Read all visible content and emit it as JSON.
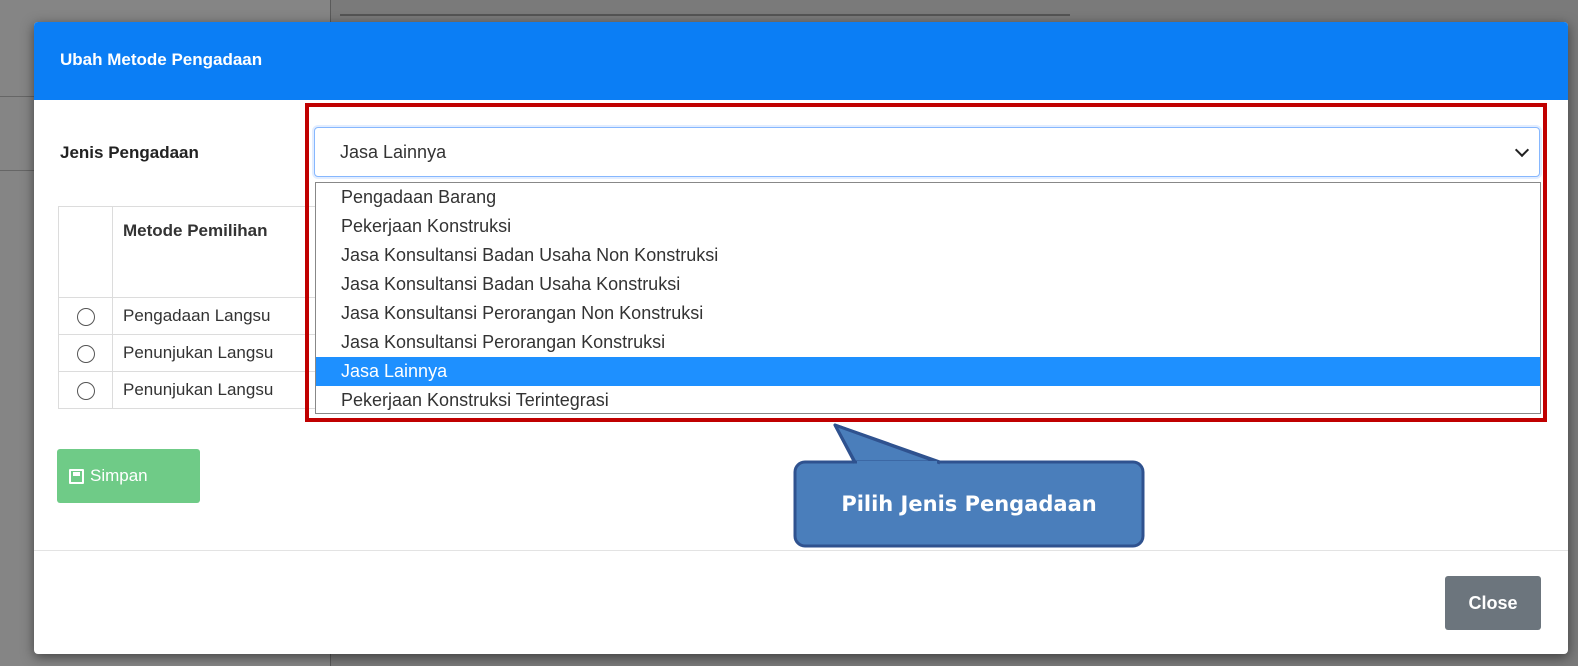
{
  "modal": {
    "title": "Ubah Metode Pengadaan",
    "jenis_label": "Jenis Pengadaan"
  },
  "select": {
    "value": "Jasa Lainnya",
    "options": [
      "Pengadaan Barang",
      "Pekerjaan Konstruksi",
      "Jasa Konsultansi Badan Usaha Non Konstruksi",
      "Jasa Konsultansi Badan Usaha Konstruksi",
      "Jasa Konsultansi Perorangan Non Konstruksi",
      "Jasa Konsultansi Perorangan Konstruksi",
      "Jasa Lainnya",
      "Pekerjaan Konstruksi Terintegrasi"
    ],
    "selected_index": 6
  },
  "table": {
    "header": "Metode Pemilihan",
    "rows": [
      "Pengadaan Langsu",
      "Penunjukan Langsu",
      "Penunjukan Langsu"
    ]
  },
  "buttons": {
    "save": "Simpan",
    "close": "Close"
  },
  "callout": {
    "text": "Pilih Jenis Pengadaan"
  },
  "colors": {
    "header": "#0b7ef5",
    "save_button": "#6fcb87",
    "close_button": "#6c757d",
    "highlight_border": "#c00000",
    "callout_fill": "#4a7ebb",
    "selected_option": "#1e90ff"
  }
}
